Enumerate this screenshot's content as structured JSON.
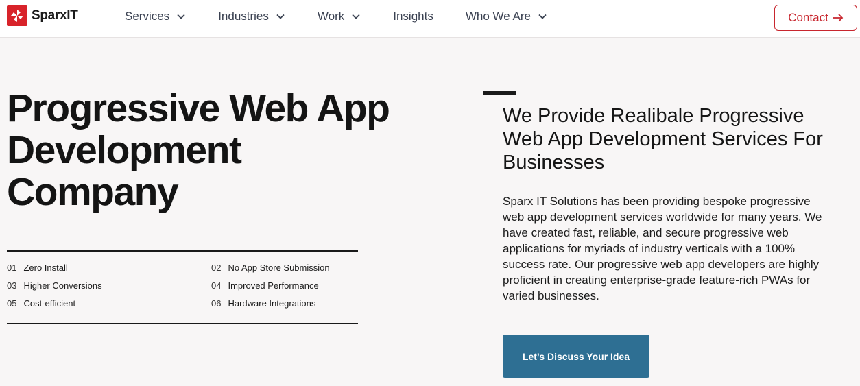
{
  "brand": {
    "name": "SparxIT",
    "accent_color": "#d8232a",
    "logo_icon": "pinwheel-icon"
  },
  "nav": {
    "items": [
      {
        "label": "Services",
        "has_dropdown": true
      },
      {
        "label": "Industries",
        "has_dropdown": true
      },
      {
        "label": "Work",
        "has_dropdown": true
      },
      {
        "label": "Insights",
        "has_dropdown": false
      },
      {
        "label": "Who We Are",
        "has_dropdown": true
      }
    ],
    "contact_label": "Contact",
    "contact_icon": "arrow-right-icon"
  },
  "hero": {
    "title_lines": [
      "Progressive Web App",
      "Development",
      "Company"
    ],
    "features": [
      {
        "num": "01",
        "label": "Zero Install"
      },
      {
        "num": "02",
        "label": "No App Store Submission"
      },
      {
        "num": "03",
        "label": "Higher Conversions"
      },
      {
        "num": "04",
        "label": "Improved Performance"
      },
      {
        "num": "05",
        "label": "Cost-efficient"
      },
      {
        "num": "06",
        "label": "Hardware Integrations"
      }
    ],
    "sub_heading": "We Provide Realibale Progressive Web App Development Services For Businesses",
    "body": "Sparx IT Solutions has been providing bespoke progressive web app development services worldwide for many years. We have created fast, reliable, and secure progressive web applications for myriads of industry verticals with a 100% success rate. Our progressive web app developers are highly proficient in creating enterprise-grade feature-rich PWAs for varied businesses.",
    "cta_label": "Let’s Discuss Your Idea",
    "cta_color": "#2e6f93"
  }
}
